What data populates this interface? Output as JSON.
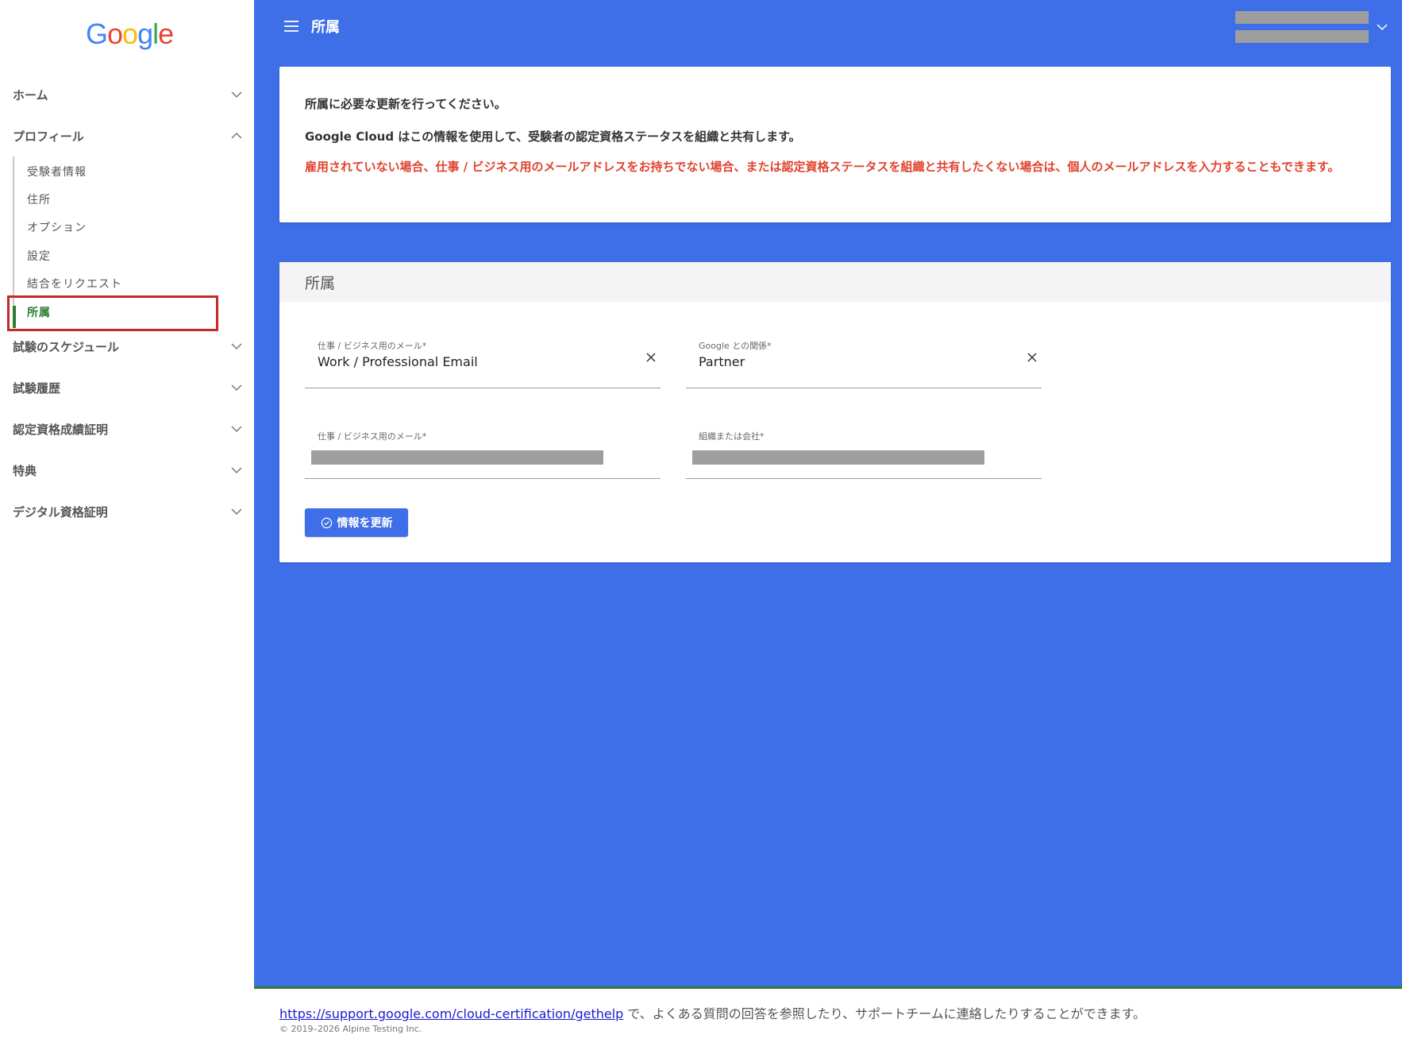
{
  "brand": {
    "logo_letters": [
      {
        "ch": "G",
        "color": "#4285F4"
      },
      {
        "ch": "o",
        "color": "#EA4335"
      },
      {
        "ch": "o",
        "color": "#FBBC05"
      },
      {
        "ch": "g",
        "color": "#4285F4"
      },
      {
        "ch": "l",
        "color": "#34A853"
      },
      {
        "ch": "e",
        "color": "#EA4335"
      }
    ]
  },
  "sidebar": {
    "sections": [
      {
        "label": "ホーム",
        "expanded": false
      },
      {
        "label": "プロフィール",
        "expanded": true
      },
      {
        "label": "試験のスケジュール",
        "expanded": false
      },
      {
        "label": "試験履歴",
        "expanded": false
      },
      {
        "label": "認定資格成績証明",
        "expanded": false
      },
      {
        "label": "特典",
        "expanded": false
      },
      {
        "label": "デジタル資格証明",
        "expanded": false
      }
    ],
    "profile_items": [
      {
        "label": "受験者情報"
      },
      {
        "label": "住所"
      },
      {
        "label": "オプション"
      },
      {
        "label": "設定"
      },
      {
        "label": "結合をリクエスト"
      },
      {
        "label": "所属",
        "active": true
      }
    ]
  },
  "topbar": {
    "title": "所属"
  },
  "notice": {
    "line1": "所属に必要な更新を行ってください。",
    "line2": "Google Cloud はこの情報を使用して、受験者の認定資格ステータスを組織と共有します。",
    "warning": "雇用されていない場合、仕事 / ビジネス用のメールアドレスをお持ちでない場合、または認定資格ステータスを組織と共有したくない場合は、個人のメールアドレスを入力することもできます。"
  },
  "affiliation": {
    "header": "所属",
    "fields": {
      "email_type": {
        "label": "仕事 / ビジネス用のメール*",
        "value": "Work / Professional Email"
      },
      "relationship": {
        "label": "Google との関係*",
        "value": "Partner"
      },
      "email": {
        "label": "仕事 / ビジネス用のメール*"
      },
      "organization": {
        "label": "組織または会社*"
      }
    },
    "submit_label": "情報を更新"
  },
  "footer": {
    "link": "https://support.google.com/cloud-certification/gethelp",
    "text": " で、よくある質問の回答を参照したり、サポートチームに連絡したりすることができます。",
    "copyright": "© 2019–2026 Alpine Testing Inc."
  },
  "colors": {
    "main_bg": "#3e6fe8",
    "active_green": "#2e7d32",
    "warning_red": "#e0432e",
    "highlight_red": "#c62828"
  }
}
